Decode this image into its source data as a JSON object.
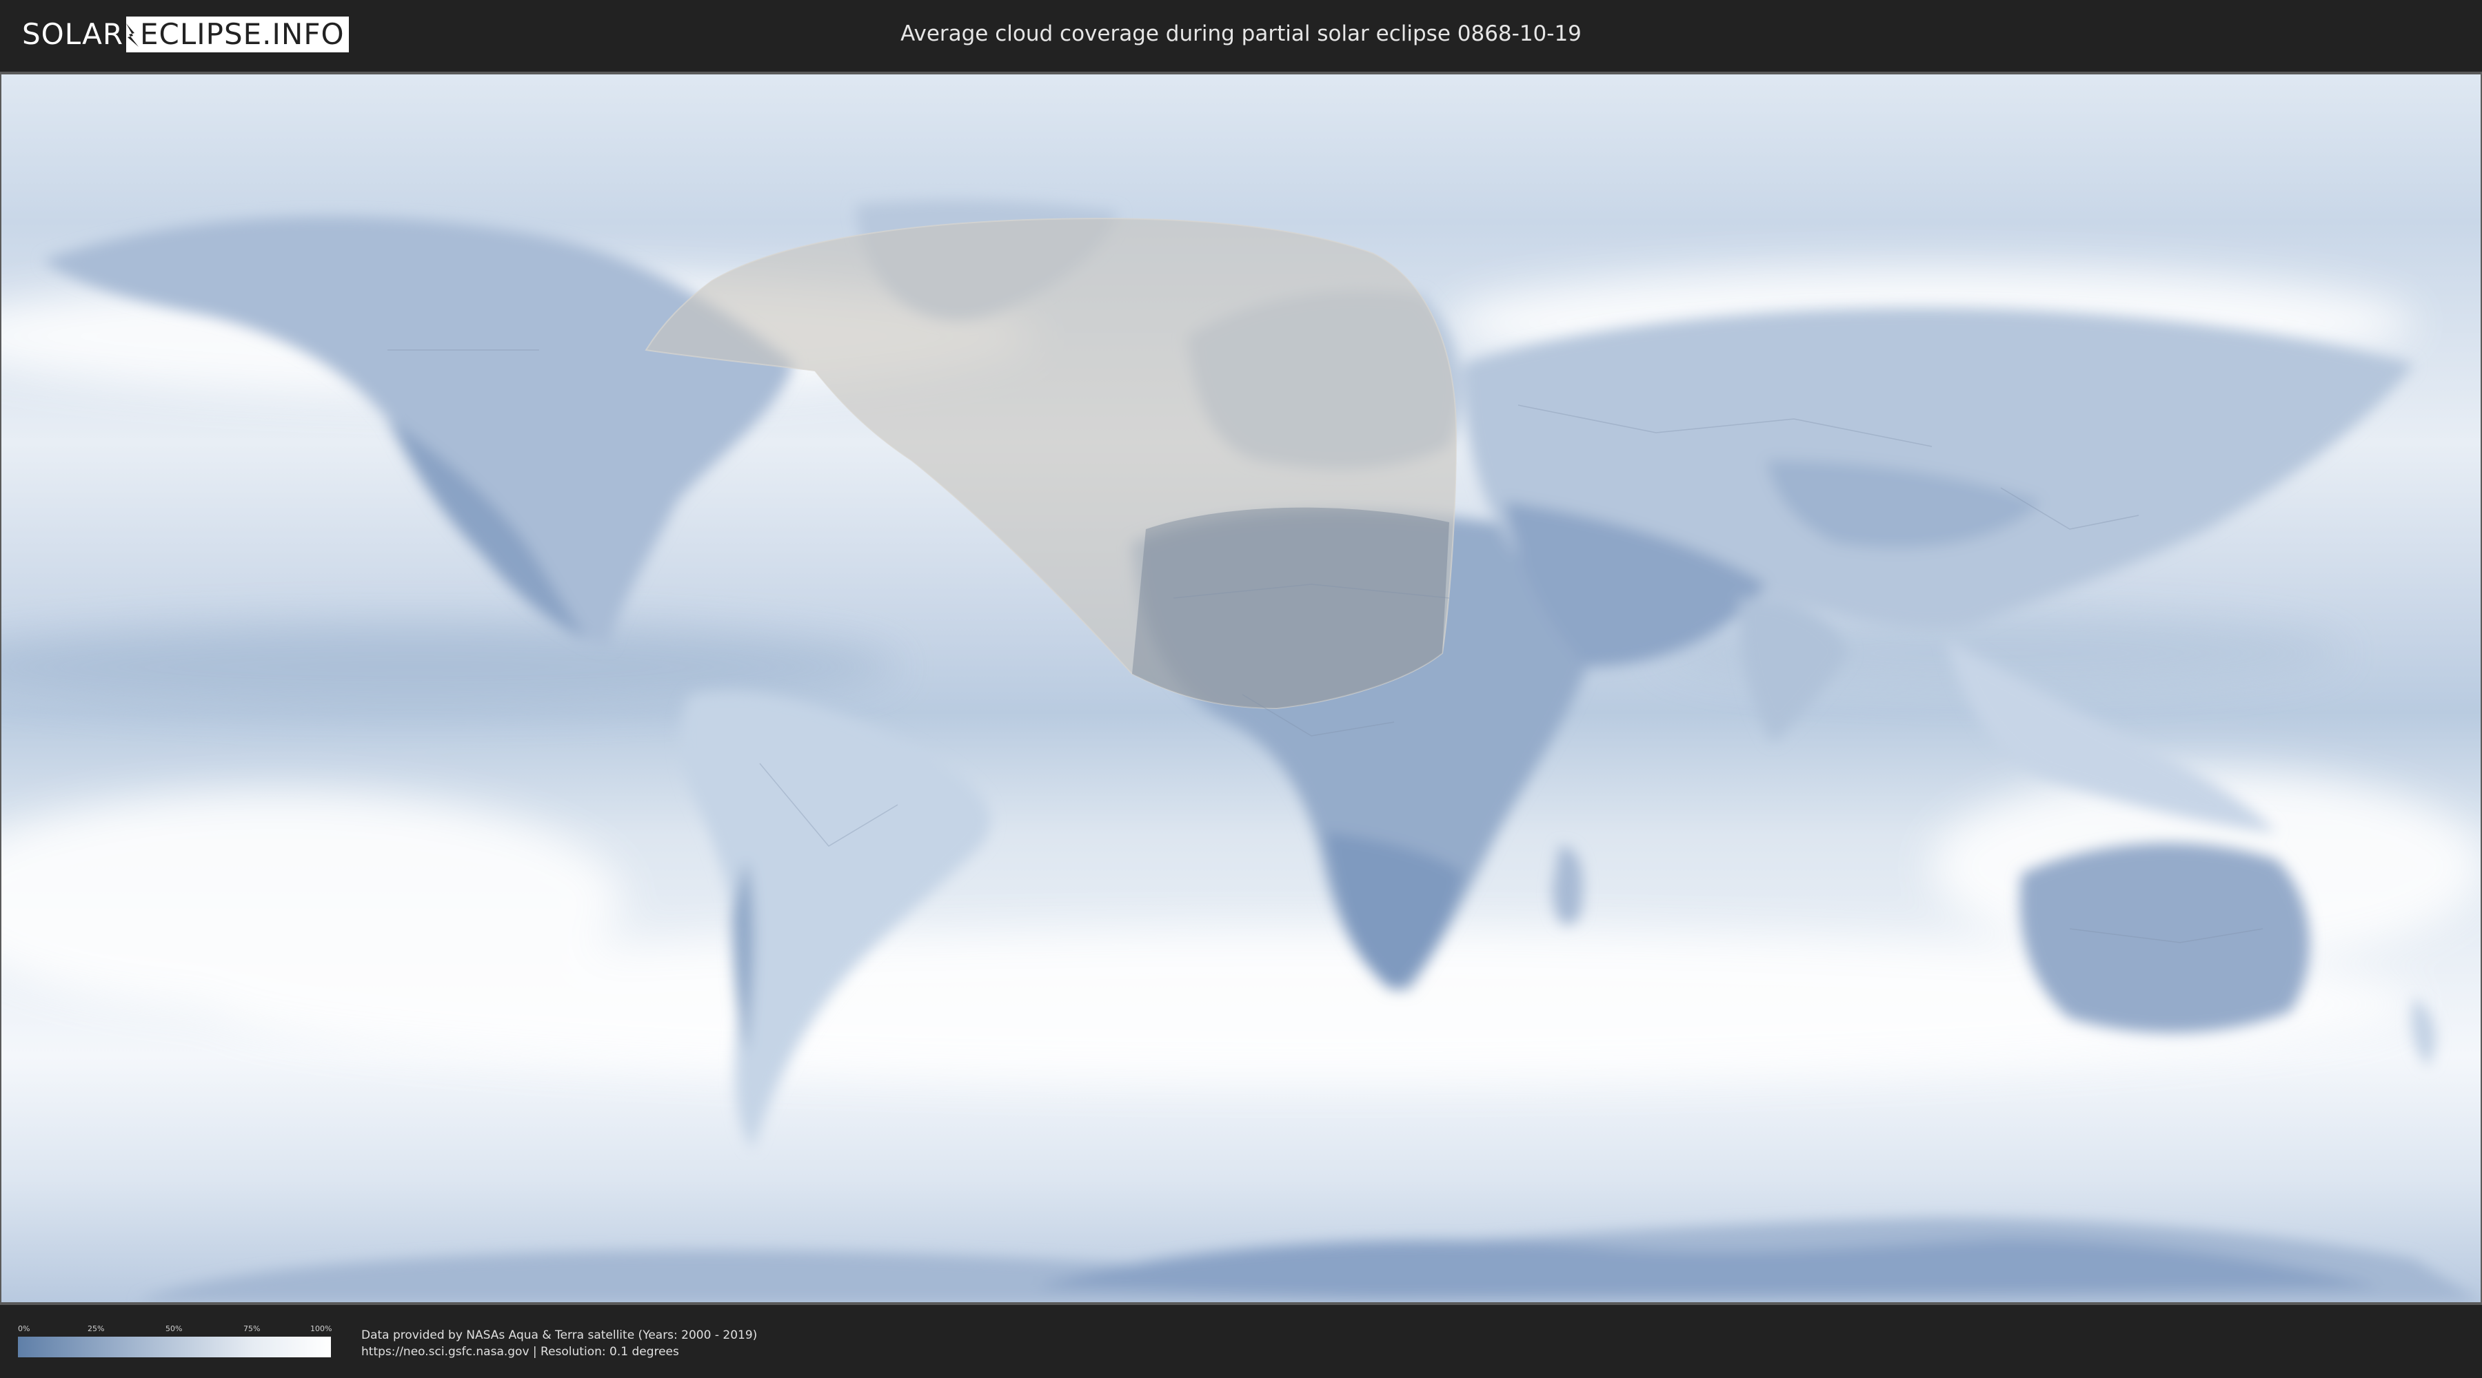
{
  "header": {
    "logo_left": "SOLAR",
    "logo_right": "ECLIPSE.INFO",
    "title": "Average cloud coverage during partial solar eclipse 0868-10-19"
  },
  "colors": {
    "background": "#222222",
    "clear_sky": "#5f7fa8",
    "full_cloud": "#ffffff",
    "eclipse_zone": "#c8c4be"
  },
  "legend": {
    "ticks": [
      "0%",
      "25%",
      "50%",
      "75%",
      "100%"
    ]
  },
  "footer": {
    "line1": "Data provided by NASAs Aqua & Terra satellite (Years: 2000 - 2019)",
    "line2": "https://neo.sci.gsfc.nasa.gov | Resolution: 0.1 degrees"
  },
  "icons": {
    "logo_mark": "lightning-bolt-icon"
  }
}
